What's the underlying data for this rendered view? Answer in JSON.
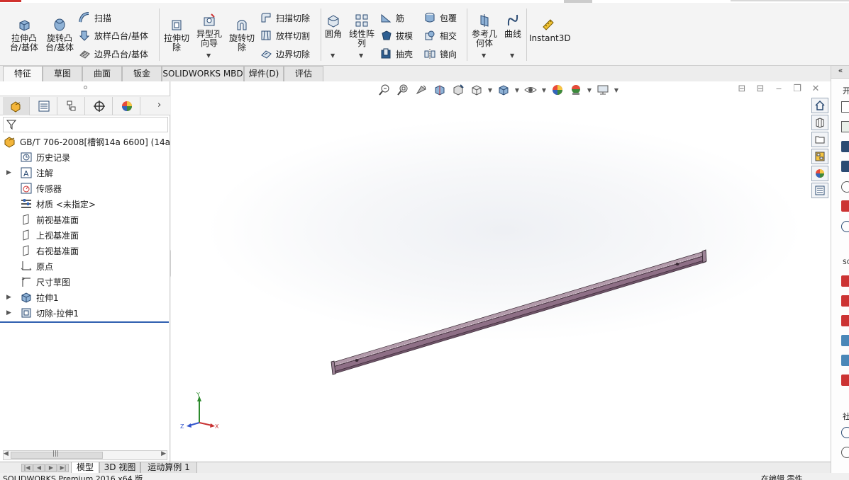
{
  "ribbon": {
    "extrude_boss": "拉伸凸\n台/基体",
    "revolve_boss": "旋转凸\n台/基体",
    "sweep": "扫描",
    "loft_boss": "放样凸台/基体",
    "boundary_boss": "边界凸台/基体",
    "extrude_cut": "拉伸切\n除",
    "hole_wizard": "异型孔\n向导",
    "revolve_cut": "旋转切\n除",
    "swept_cut": "扫描切除",
    "lofted_cut": "放样切割",
    "boundary_cut": "边界切除",
    "fillet": "圆角",
    "linear_pattern": "线性阵\n列",
    "rib": "筋",
    "wrap": "包覆",
    "draft": "拔模",
    "intersect": "相交",
    "shell": "抽壳",
    "mirror": "镜向",
    "ref_geometry": "参考几\n何体",
    "curves": "曲线",
    "instant3d": "Instant3D"
  },
  "command_tabs": [
    "特征",
    "草图",
    "曲面",
    "钣金",
    "SOLIDWORKS MBD",
    "焊件(D)",
    "评估"
  ],
  "tree": {
    "root": "GB/T 706-2008[槽钢14a 6600]  (14a",
    "items": [
      {
        "label": "历史记录",
        "icon": "history-icon"
      },
      {
        "label": "注解",
        "icon": "annotations-icon"
      },
      {
        "label": "传感器",
        "icon": "sensors-icon"
      },
      {
        "label": "材质 <未指定>",
        "icon": "material-icon"
      },
      {
        "label": "前视基准面",
        "icon": "plane-icon"
      },
      {
        "label": "上视基准面",
        "icon": "plane-icon"
      },
      {
        "label": "右视基准面",
        "icon": "plane-icon"
      },
      {
        "label": "原点",
        "icon": "origin-icon"
      },
      {
        "label": "尺寸草图",
        "icon": "sketch-icon"
      },
      {
        "label": "拉伸1",
        "icon": "extrude-feature-icon"
      },
      {
        "label": "切除-拉伸1",
        "icon": "cut-extrude-feature-icon"
      }
    ]
  },
  "triad": {
    "x": "X",
    "y": "Y",
    "z": "Z"
  },
  "bottom_tabs": [
    "模型",
    "3D 视图",
    "运动算例 1"
  ],
  "status": {
    "left": "SOLIDWORKS Premium 2016 x64 版",
    "right": "在编辑 零件"
  },
  "taskpane": {
    "t1": "开",
    "t2": "SO",
    "t3": "社"
  },
  "colors": {
    "part": "#8e6f86",
    "accent": "#2f5fb0"
  }
}
